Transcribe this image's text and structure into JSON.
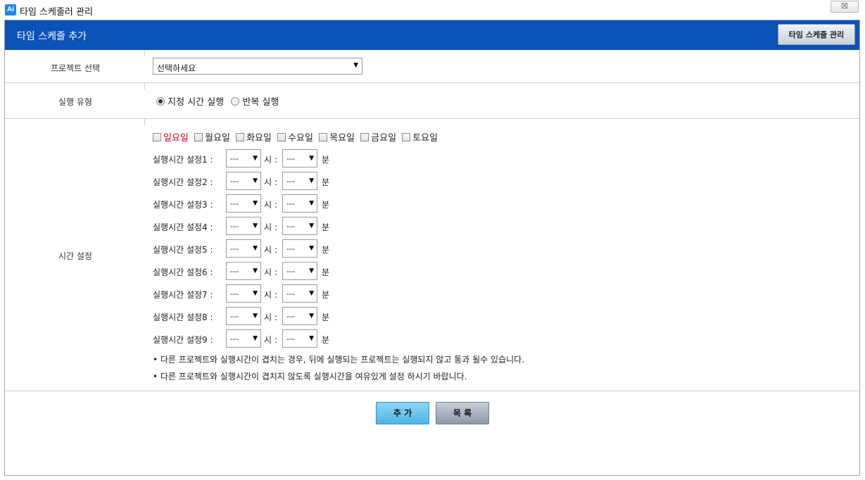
{
  "window": {
    "logo": "Ai",
    "title": "타임 스케줄러 관리",
    "close_label": "☒"
  },
  "header": {
    "title": "타임 스케줄 추가",
    "manage_button": "타임 스케줄 관리"
  },
  "project": {
    "label": "프로젝트 선택",
    "selected": "선택하세요"
  },
  "run_type": {
    "label": "실행 유형",
    "options": [
      {
        "label": "지정 시간 실행",
        "checked": true
      },
      {
        "label": "반복 실행",
        "checked": false
      }
    ]
  },
  "time": {
    "label": "시간 설정",
    "days": [
      "일요일",
      "월요일",
      "화요일",
      "수요일",
      "목요일",
      "금요일",
      "토요일"
    ],
    "hour_unit": "시 :",
    "minute_unit": "분",
    "rows": [
      {
        "label": "실행시간 설정1 :",
        "hour": "---",
        "minute": "---"
      },
      {
        "label": "실행시간 설정2 :",
        "hour": "---",
        "minute": "---"
      },
      {
        "label": "실행시간 설정3 :",
        "hour": "---",
        "minute": "---"
      },
      {
        "label": "실행시간 설정4 :",
        "hour": "---",
        "minute": "---"
      },
      {
        "label": "실행시간 설정5 :",
        "hour": "---",
        "minute": "---"
      },
      {
        "label": "실행시간 설정6 :",
        "hour": "---",
        "minute": "---"
      },
      {
        "label": "실행시간 설정7 :",
        "hour": "---",
        "minute": "---"
      },
      {
        "label": "실행시간 설정8 :",
        "hour": "---",
        "minute": "---"
      },
      {
        "label": "실행시간 설정9 :",
        "hour": "---",
        "minute": "---"
      }
    ],
    "notes": [
      "• 다른 프로젝트와 실행시간이 겹치는 경우, 뒤에 실행되는 프로젝트는 실행되지 않고 통과 될수 있습니다.",
      "• 다른 프로젝트와 실행시간이 겹치지 않도록 실행시간을 여유있게 설정 하시기 바랍니다."
    ]
  },
  "actions": {
    "add": "추 가",
    "list": "목 록"
  }
}
